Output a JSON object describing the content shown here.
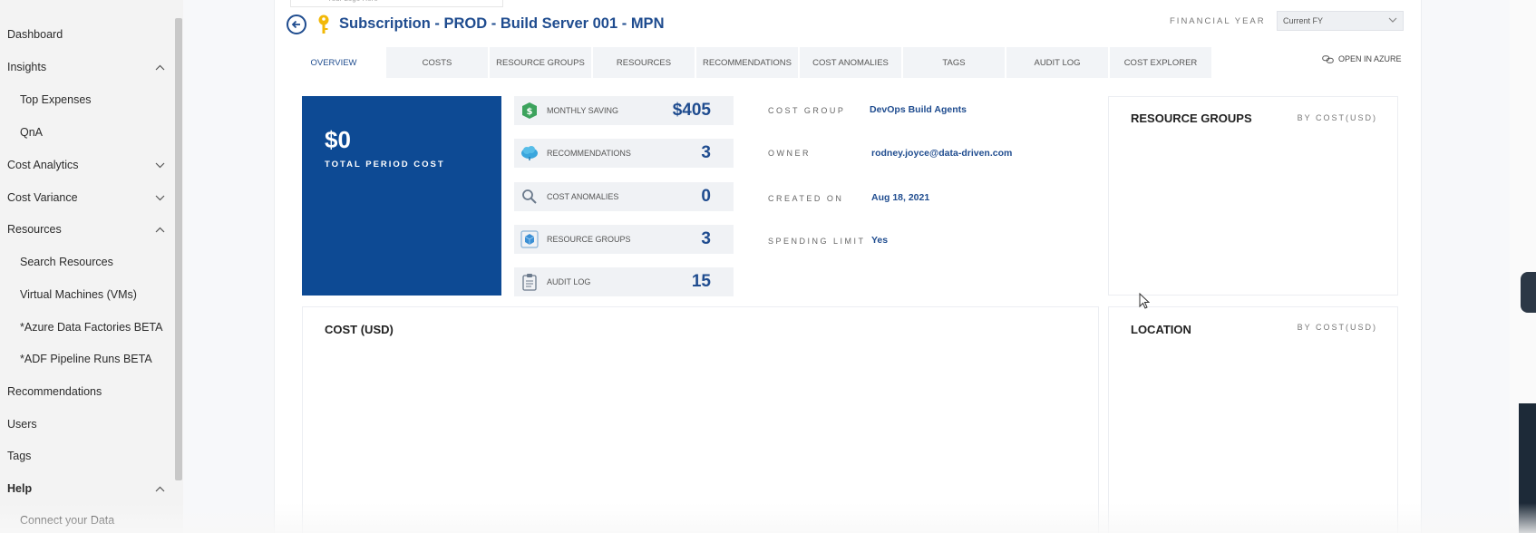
{
  "sidebar": {
    "items": [
      {
        "label": "Dashboard"
      },
      {
        "label": "Insights"
      },
      {
        "label": "Top Expenses"
      },
      {
        "label": "QnA"
      },
      {
        "label": "Cost Analytics"
      },
      {
        "label": "Cost Variance"
      },
      {
        "label": "Resources"
      },
      {
        "label": "Search Resources"
      },
      {
        "label": "Virtual Machines (VMs)"
      },
      {
        "label": "*Azure Data Factories BETA"
      },
      {
        "label": "*ADF Pipeline Runs BETA"
      },
      {
        "label": "Recommendations"
      },
      {
        "label": "Users"
      },
      {
        "label": "Tags"
      },
      {
        "label": "Help"
      },
      {
        "label": "Connect your Data"
      }
    ]
  },
  "header": {
    "logo_text": "Your Logo Here",
    "title": "Subscription - PROD - Build Server 001 - MPN",
    "financial_year_label": "FINANCIAL YEAR",
    "financial_year_value": "Current FY"
  },
  "tabs": [
    {
      "label": "OVERVIEW"
    },
    {
      "label": "COSTS"
    },
    {
      "label": "RESOURCE GROUPS"
    },
    {
      "label": "RESOURCES"
    },
    {
      "label": "RECOMMENDATIONS"
    },
    {
      "label": "COST ANOMALIES"
    },
    {
      "label": "TAGS"
    },
    {
      "label": "AUDIT LOG"
    },
    {
      "label": "COST EXPLORER"
    }
  ],
  "open_in_azure": "OPEN IN AZURE",
  "total": {
    "value": "$0",
    "label": "TOTAL PERIOD COST"
  },
  "kpis": [
    {
      "label": "MONTHLY SAVING",
      "value": "$405",
      "icon": "dollar-shield-icon"
    },
    {
      "label": "RECOMMENDATIONS",
      "value": "3",
      "icon": "cloud-icon"
    },
    {
      "label": "COST ANOMALIES",
      "value": "0",
      "icon": "magnifier-icon"
    },
    {
      "label": "RESOURCE GROUPS",
      "value": "3",
      "icon": "cube-icon"
    },
    {
      "label": "AUDIT LOG",
      "value": "15",
      "icon": "clipboard-icon"
    }
  ],
  "details": {
    "cost_group_label": "COST GROUP",
    "cost_group_value": "DevOps Build Agents",
    "owner_label": "OWNER",
    "owner_value": "rodney.joyce@data-driven.com",
    "created_label": "CREATED ON",
    "created_value": "Aug 18, 2021",
    "spending_label": "SPENDING LIMIT",
    "spending_value": "Yes"
  },
  "cards": {
    "resource_groups_title": "RESOURCE GROUPS",
    "resource_groups_sub": "BY COST(USD)",
    "cost_title": "COST (USD)",
    "location_title": "LOCATION",
    "location_sub": "BY COST(USD)"
  },
  "colors": {
    "brand": "#1f4c8f",
    "tile": "#0d4a94"
  }
}
